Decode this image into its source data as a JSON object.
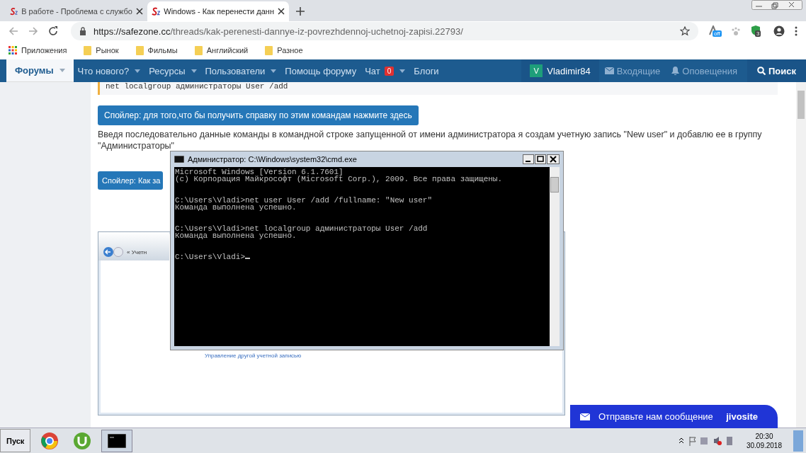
{
  "browser": {
    "tabs": [
      {
        "title": "В работе - Проблема с службо",
        "selected": false
      },
      {
        "title": "Windows - Как перенести данн",
        "selected": true
      }
    ],
    "url": {
      "host": "https://safezone.cc",
      "path": "/threads/kak-perenesti-dannye-iz-povrezhdennoj-uchetnoj-zapisi.22793/"
    },
    "extension_badges": [
      "off",
      "3"
    ],
    "bookmarks": [
      "Приложения",
      "Рынок",
      "Фильмы",
      "Английский",
      "Разное"
    ]
  },
  "site_nav": {
    "items": [
      {
        "label": "Форумы",
        "selected": true,
        "dropdown": true
      },
      {
        "label": "Что нового?",
        "selected": false,
        "dropdown": true
      },
      {
        "label": "Ресурсы",
        "selected": false,
        "dropdown": true
      },
      {
        "label": "Пользователи",
        "selected": false,
        "dropdown": true
      },
      {
        "label": "Помощь форуму",
        "selected": false,
        "dropdown": false
      },
      {
        "label": "Чат",
        "selected": false,
        "dropdown": true,
        "badge": "0"
      },
      {
        "label": "Блоги",
        "selected": false,
        "dropdown": false
      }
    ],
    "user": {
      "initial": "V",
      "name": "Vladimir84"
    },
    "right": [
      {
        "kind": "mail",
        "label": "Входящие"
      },
      {
        "kind": "bell",
        "label": "Оповещения"
      },
      {
        "kind": "search",
        "label": "Поиск"
      }
    ]
  },
  "post": {
    "code_line": "net localgroup администраторы User /add",
    "spoiler_1": "Спойлер: для того,что бы получить справку по этим командам нажмите здесь",
    "paragraph": [
      "Введя последовательно данные команды в командной строке запущенной от имени администратора я создам учетную запись \"New user\" и добавлю ее в группу",
      "\"Администраторы\""
    ],
    "spoiler_2": "Спойлер: Как за",
    "embedded_screenshot": {
      "breadcrumb": "« Учетн",
      "link": "Управление другой учетной записью"
    }
  },
  "cmd_window": {
    "title": "Администратор: C:\\Windows\\system32\\cmd.exe",
    "blocks": [
      [
        "Microsoft Windows [Version 6.1.7601]",
        "(c) Корпорация Майкрософт (Microsoft Corp.), 2009. Все права защищены."
      ],
      [
        "C:\\Users\\Vladi>net user User /add /fullname: \"New user\"",
        "Команда выполнена успешно."
      ],
      [
        "C:\\Users\\Vladi>net localgroup администраторы User /add",
        "Команда выполнена успешно."
      ],
      [
        "C:\\Users\\Vladi>"
      ]
    ]
  },
  "chat_widget": {
    "label": "Отправьте нам сообщение",
    "brand": "jivosite"
  },
  "taskbar": {
    "start": "Пуск",
    "time": "20:30",
    "date": "30.09.2018"
  }
}
